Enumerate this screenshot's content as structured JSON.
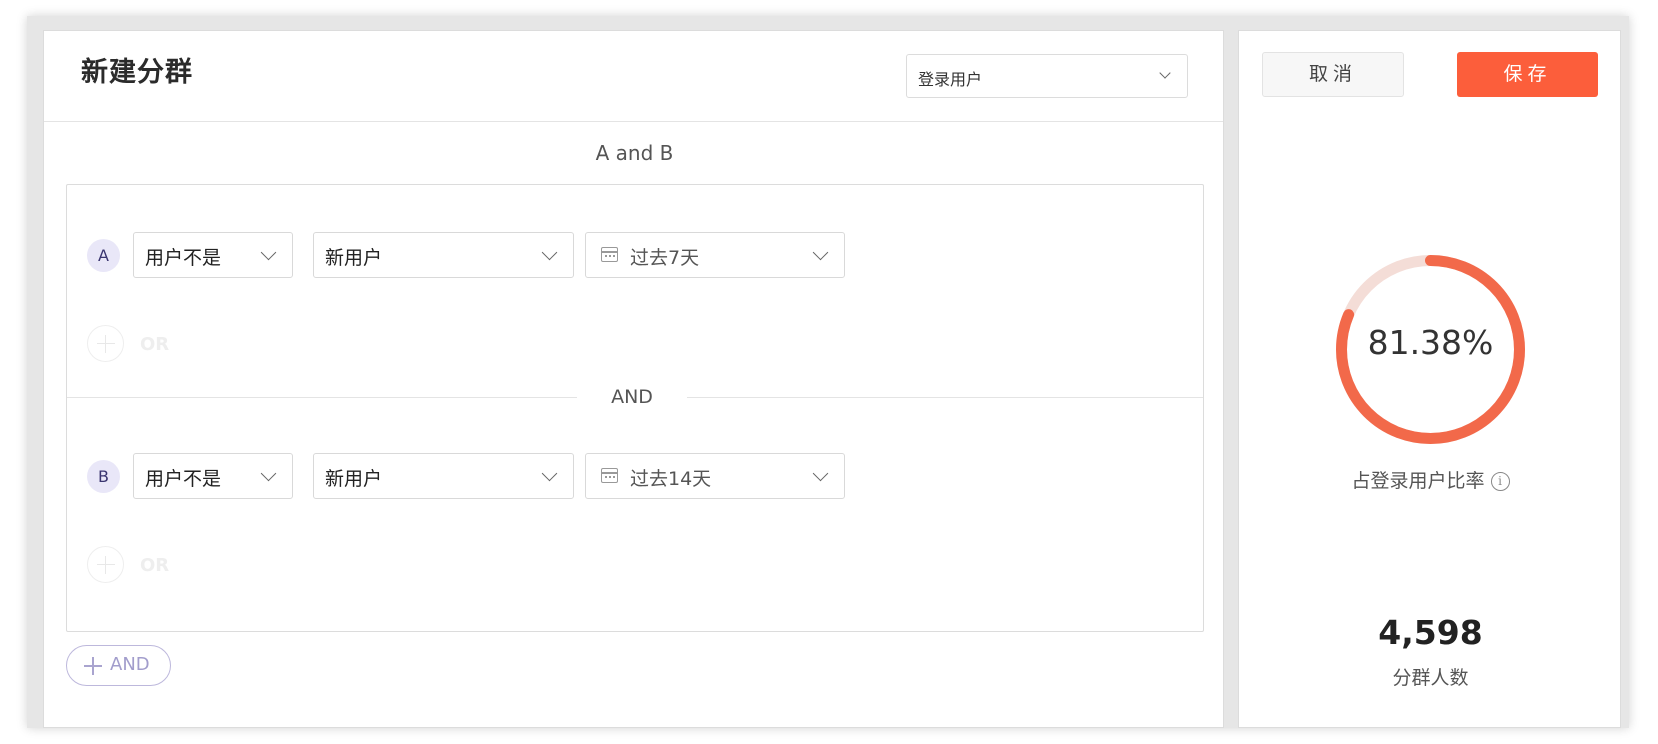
{
  "header": {
    "title": "新建分群",
    "scope_select": {
      "value": "登录用户"
    }
  },
  "logic_expression": "A and B",
  "conditions": [
    {
      "letter": "A",
      "subject": "用户不是",
      "segment": "新用户",
      "date_range": "过去7天",
      "or_label": "OR"
    },
    {
      "letter": "B",
      "subject": "用户不是",
      "segment": "新用户",
      "date_range": "过去14天",
      "or_label": "OR"
    }
  ],
  "and_separator": "AND",
  "add_and_label": "AND",
  "actions": {
    "cancel": "取消",
    "save": "保存"
  },
  "stats": {
    "ratio_text": "81.38%",
    "ratio_value": 0.8138,
    "ratio_label": "占登录用户比率",
    "count": "4,598",
    "count_label": "分群人数"
  },
  "colors": {
    "accent": "#fc5e3b",
    "ring_fill": "#f2694a",
    "ring_track": "#f4ddd7",
    "condition_letter_bg": "#e9e7f8",
    "add_and_text": "#a29dcc"
  },
  "icons": [
    "chevron-down-icon",
    "calendar-icon",
    "plus-icon",
    "info-icon"
  ]
}
